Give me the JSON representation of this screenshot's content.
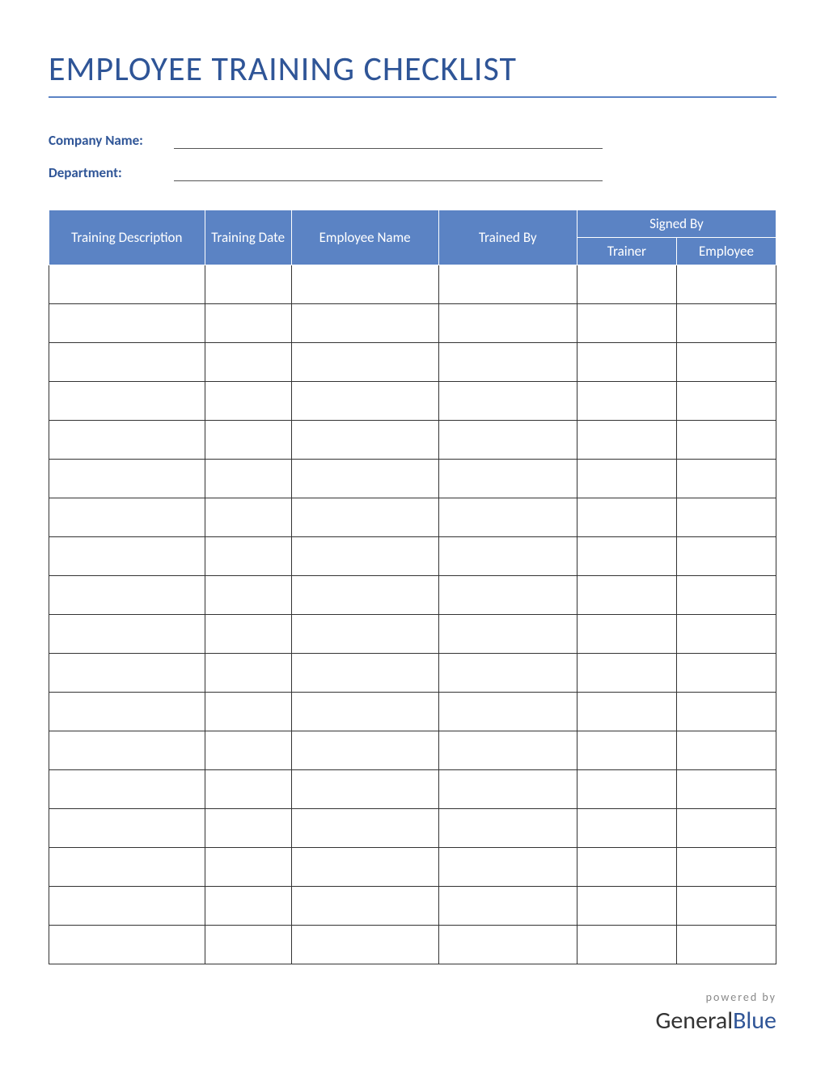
{
  "title": "EMPLOYEE TRAINING CHECKLIST",
  "info": {
    "company_label": "Company Name:",
    "department_label": "Department:"
  },
  "table": {
    "headers": {
      "description": "Training Description",
      "date": "Training Date",
      "employee": "Employee Name",
      "trained_by": "Trained By",
      "signed_by": "Signed By",
      "signed_trainer": "Trainer",
      "signed_employee": "Employee"
    },
    "row_count": 18
  },
  "footer": {
    "powered": "powered by",
    "brand_a": "General",
    "brand_b": "Blue"
  }
}
